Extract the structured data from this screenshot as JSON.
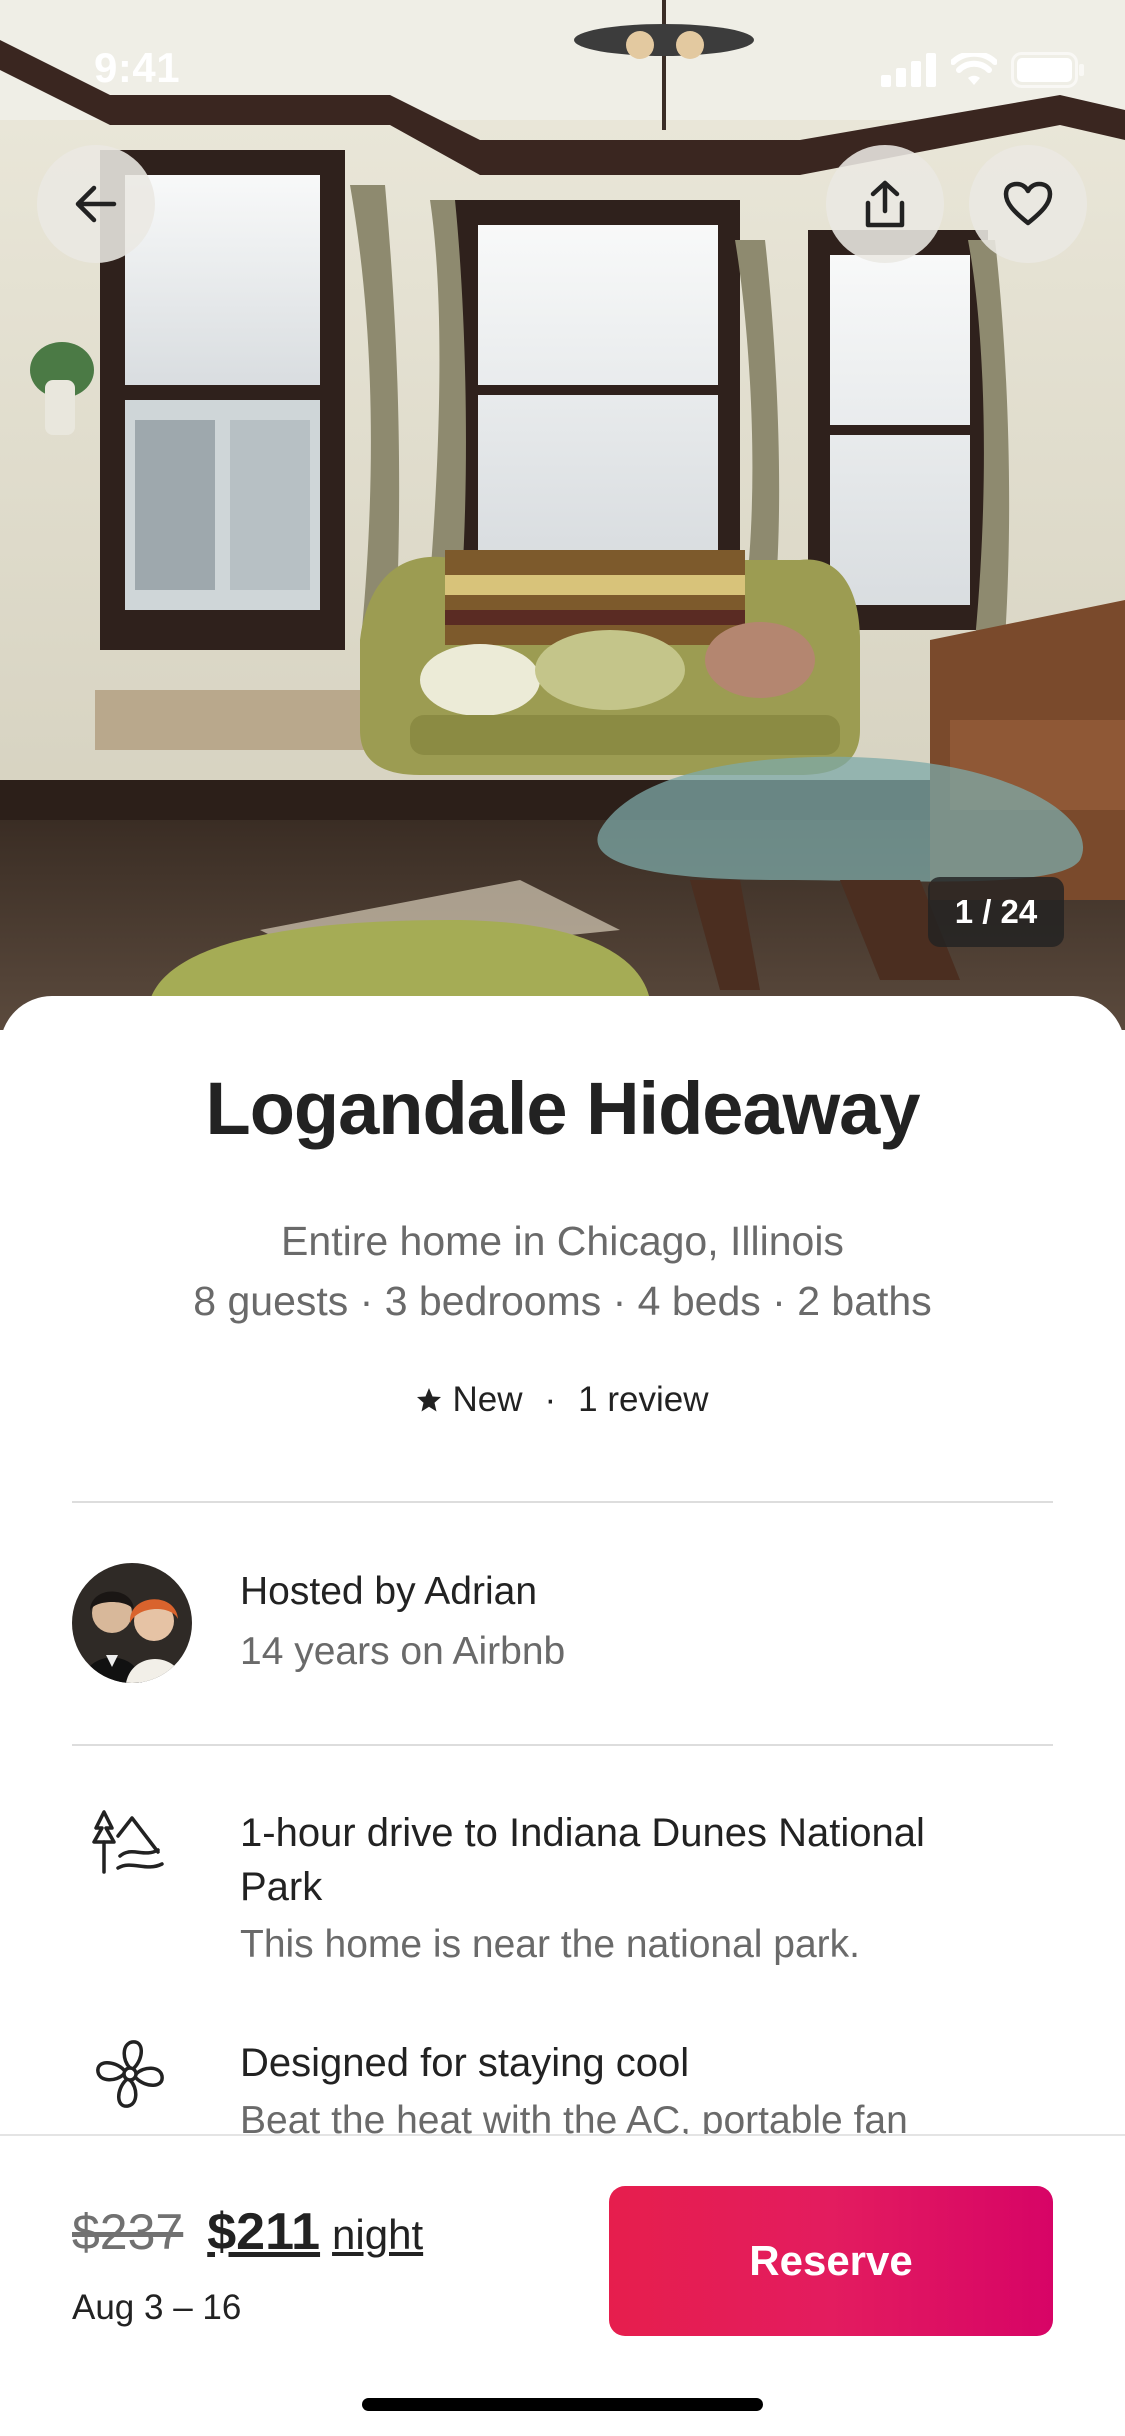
{
  "status_bar": {
    "time": "9:41"
  },
  "hero": {
    "photo_counter": "1 / 24"
  },
  "listing": {
    "title": "Logandale Hideaway",
    "subtitle_line1": "Entire home in Chicago, Illinois",
    "subtitle_line2": "8 guests · 3 bedrooms · 4 beds · 2 baths",
    "rating_label": "New",
    "rating_separator": "·",
    "reviews": "1 review"
  },
  "host": {
    "name": "Hosted by Adrian",
    "tenure": "14 years on Airbnb"
  },
  "highlights": [
    {
      "icon": "national-park-icon",
      "title": "1-hour drive to Indiana Dunes National Park",
      "description": "This home is near the national park."
    },
    {
      "icon": "fan-icon",
      "title": "Designed for staying cool",
      "description": "Beat the heat with the AC, portable fan"
    }
  ],
  "booking": {
    "original_price": "$237",
    "price": "$211",
    "price_unit": "night",
    "dates": "Aug 3 – 16",
    "reserve_label": "Reserve"
  },
  "colors": {
    "brand": "#E31C5F",
    "text": "#222222",
    "secondary_text": "#6A6A6A"
  }
}
